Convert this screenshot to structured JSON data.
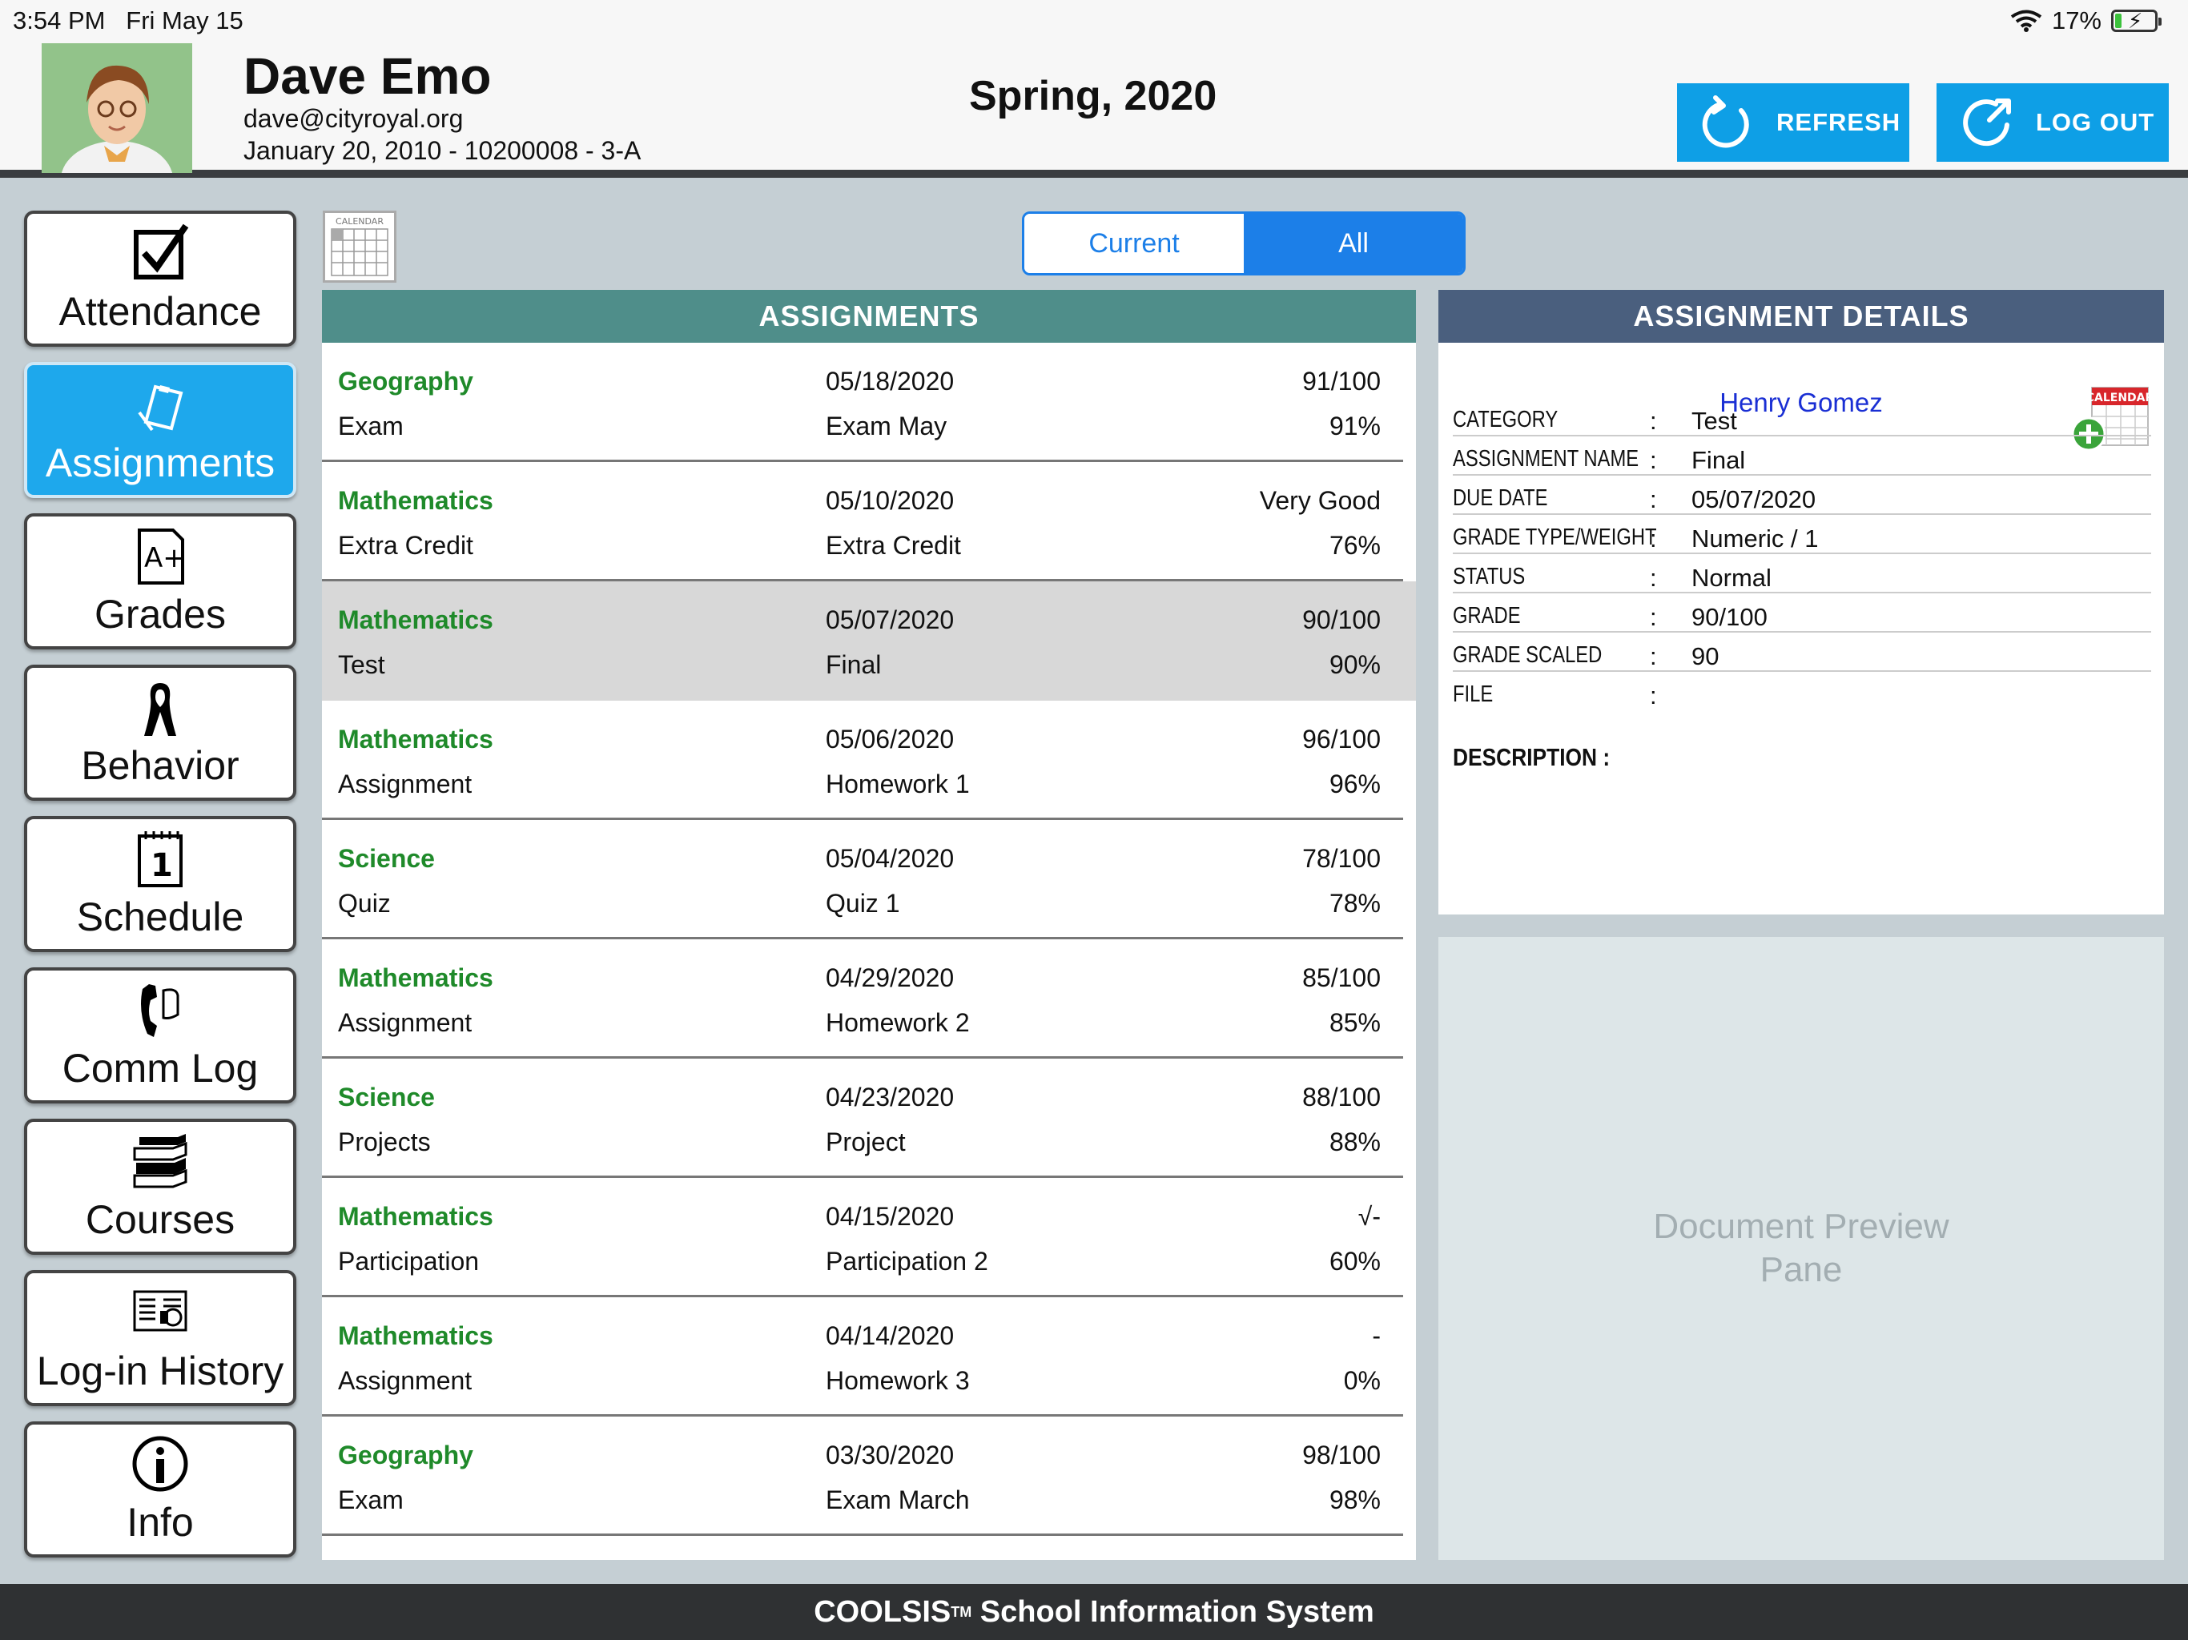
{
  "status_bar": {
    "time": "3:54 PM",
    "date": "Fri May 15",
    "battery": "17%",
    "battery_level": 0.17
  },
  "header": {
    "name": "Dave Emo",
    "email": "dave@cityroyal.org",
    "info": "January 20, 2010 - 10200008 - 3-A",
    "term": "Spring, 2020",
    "refresh_label": "REFRESH",
    "logout_label": "LOG OUT"
  },
  "sidebar": {
    "items": [
      {
        "label": "Attendance",
        "icon": "checkbox-icon"
      },
      {
        "label": "Assignments",
        "icon": "clipboard-icon"
      },
      {
        "label": "Grades",
        "icon": "grade-icon"
      },
      {
        "label": "Behavior",
        "icon": "ribbon-icon"
      },
      {
        "label": "Schedule",
        "icon": "calendar-icon"
      },
      {
        "label": "Comm Log",
        "icon": "phone-icon"
      },
      {
        "label": "Courses",
        "icon": "books-icon"
      },
      {
        "label": "Log-in History",
        "icon": "history-icon"
      },
      {
        "label": "Info",
        "icon": "info-icon"
      }
    ]
  },
  "calendar_icon_label": "CALENDAR",
  "segmented": {
    "current": "Current",
    "all": "All"
  },
  "assignments": {
    "title": "ASSIGNMENTS",
    "rows": [
      {
        "course": "Geography",
        "category": "Exam",
        "date": "05/18/2020",
        "name": "Exam May",
        "score": "91/100",
        "percent": "91%"
      },
      {
        "course": "Mathematics",
        "category": "Extra Credit",
        "date": "05/10/2020",
        "name": "Extra Credit",
        "score": "Very Good",
        "percent": "76%"
      },
      {
        "course": "Mathematics",
        "category": "Test",
        "date": "05/07/2020",
        "name": "Final",
        "score": "90/100",
        "percent": "90%"
      },
      {
        "course": "Mathematics",
        "category": "Assignment",
        "date": "05/06/2020",
        "name": "Homework 1",
        "score": "96/100",
        "percent": "96%"
      },
      {
        "course": "Science",
        "category": "Quiz",
        "date": "05/04/2020",
        "name": "Quiz 1",
        "score": "78/100",
        "percent": "78%"
      },
      {
        "course": "Mathematics",
        "category": "Assignment",
        "date": "04/29/2020",
        "name": "Homework 2",
        "score": "85/100",
        "percent": "85%"
      },
      {
        "course": "Science",
        "category": "Projects",
        "date": "04/23/2020",
        "name": "Project",
        "score": "88/100",
        "percent": "88%"
      },
      {
        "course": "Mathematics",
        "category": "Participation",
        "date": "04/15/2020",
        "name": "Participation 2",
        "score": "√-",
        "percent": "60%"
      },
      {
        "course": "Mathematics",
        "category": "Assignment",
        "date": "04/14/2020",
        "name": "Homework 3",
        "score": "-",
        "percent": "0%"
      },
      {
        "course": "Geography",
        "category": "Exam",
        "date": "03/30/2020",
        "name": "Exam March",
        "score": "98/100",
        "percent": "98%"
      }
    ]
  },
  "details": {
    "title": "ASSIGNMENT DETAILS",
    "teacher": "Henry Gomez",
    "add_calendar_label": "CALENDAR",
    "fields": [
      {
        "key": "CATEGORY",
        "value": "Test"
      },
      {
        "key": "ASSIGNMENT NAME",
        "value": "Final"
      },
      {
        "key": "DUE DATE",
        "value": "05/07/2020"
      },
      {
        "key": "GRADE TYPE/WEIGHT",
        "value": "Numeric / 1"
      },
      {
        "key": "STATUS",
        "value": "Normal"
      },
      {
        "key": "GRADE",
        "value": "90/100"
      },
      {
        "key": "GRADE SCALED",
        "value": "90"
      },
      {
        "key": "FILE",
        "value": ""
      }
    ],
    "separator": ":",
    "description_label": "DESCRIPTION   :"
  },
  "preview": {
    "line1": "Document Preview",
    "line2": "Pane"
  },
  "footer": {
    "brand": "COOLSIS",
    "tm": "TM",
    "rest": " School Information System"
  },
  "colors": {
    "accent": "#0e9fe6",
    "course_green": "#1f8a2a",
    "assign_head": "#4f8e8a",
    "detail_head": "#4a5f7e",
    "teacher_blue": "#1a2fd4"
  }
}
